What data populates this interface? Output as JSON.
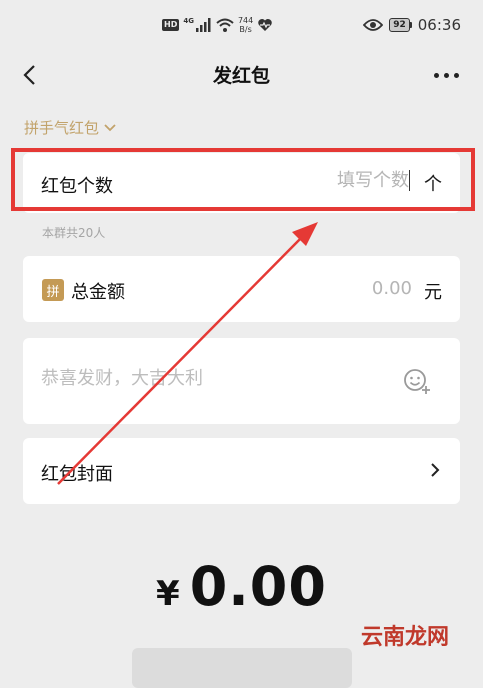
{
  "status_bar": {
    "hd": "HD",
    "network": "4G",
    "speed_value": "744",
    "speed_unit": "B/s",
    "battery": "92",
    "time": "06:36"
  },
  "nav": {
    "title": "发红包"
  },
  "type_selector": {
    "label": "拼手气红包"
  },
  "count": {
    "label": "红包个数",
    "placeholder": "填写个数",
    "unit": "个"
  },
  "member_hint": "本群共20人",
  "amount": {
    "badge": "拼",
    "label": "总金额",
    "placeholder": "0.00",
    "unit": "元"
  },
  "greeting": {
    "placeholder": "恭喜发财，大吉大利"
  },
  "cover": {
    "label": "红包封面"
  },
  "total": {
    "currency": "¥",
    "value": "0.00"
  },
  "watermark": "云南龙网",
  "colors": {
    "accent_gold": "#c2a36b",
    "badge_gold": "#c49a55",
    "annotation_red": "#e53935",
    "background": "#ededed"
  },
  "icons": [
    "back-arrow-icon",
    "more-icon",
    "chevron-down-icon",
    "emoji-add-icon",
    "chevron-right-icon",
    "signal-icon",
    "wifi-icon",
    "heart-icon",
    "eye-icon"
  ]
}
